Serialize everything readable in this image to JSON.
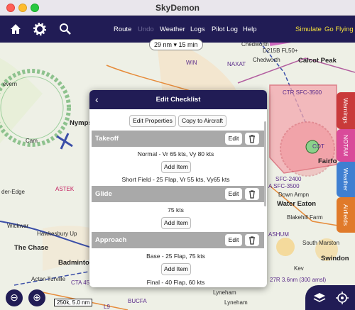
{
  "window": {
    "title": "SkyDemon"
  },
  "toolbar": {
    "icons": [
      "home-icon",
      "gear-icon",
      "search-icon"
    ],
    "menu": {
      "route": "Route",
      "undo": "Undo",
      "weather": "Weather",
      "logs": "Logs",
      "pilot_log": "Pilot Log",
      "help": "Help",
      "simulate": "Simulate",
      "go_flying": "Go Flying"
    },
    "colors": {
      "background": "#211c55",
      "accent": "#f5e13a"
    }
  },
  "map": {
    "zoom": {
      "label": "29 nm ▾ 15 min"
    },
    "labels": {
      "chedworth1": "Chedworth",
      "chedworth2": "Chedworth",
      "d215b": "D215B FL50+",
      "calcot": "Calcot Peak",
      "naxat": "NAXAT",
      "win": "WIN",
      "ctr": "CTR SFC-3500",
      "evern": "evern",
      "nympsfield": "Nymps",
      "cam": "Cam",
      "astek": "ASTEK",
      "edge": "der-Edge",
      "wickwar": "Wickwar",
      "hawkesbury": "Hawkesbury Up",
      "chase": "The Chase",
      "badminton": "Badminton",
      "acton": "Acton Turville",
      "cta": "CTA 4500",
      "bucfa": "BUCFA",
      "lyneham1": "Lyneham",
      "lyneham2": "Lyneham",
      "fairford": "Fairfo",
      "sfc2400": "SFC-2400",
      "sfc2500": "A SFC-3500",
      "downamp": "Down Ampn",
      "watereaton": "Water Eaton",
      "blakehill": "Blakehill Farm",
      "ashum": "ASHUM",
      "southmarston": "South Marston",
      "kev": "Kev",
      "swindon": "Swindon",
      "rwy": "27R 3.6nm (300 amsl)",
      "l9": "L9",
      "cot": "COT"
    },
    "scale": "250k, 5.0 nm",
    "controls": {
      "zoom_out": "⊖",
      "locate": "⊕"
    }
  },
  "side_tabs": [
    {
      "label": "Warnings",
      "color": "#c93a3a"
    },
    {
      "label": "NOTAM",
      "color": "#d94a9a"
    },
    {
      "label": "Weather",
      "color": "#3f7fd1"
    },
    {
      "label": "Airfields",
      "color": "#e07a2a"
    }
  ],
  "dialog": {
    "title": "Edit Checklist",
    "back": "‹",
    "buttons": {
      "edit_properties": "Edit Properties",
      "copy_to_aircraft": "Copy to Aircraft"
    },
    "sections": [
      {
        "name": "Takeoff",
        "edit_label": "Edit",
        "items": [
          "Normal - Vr 65 kts, Vy 80 kts"
        ],
        "add_label": "Add Item",
        "after_add": [
          "Short Field - 25 Flap, Vr 55 kts, Vy65 kts"
        ]
      },
      {
        "name": "Glide",
        "edit_label": "Edit",
        "items": [
          "75 kts"
        ],
        "add_label": "Add Item",
        "after_add": []
      },
      {
        "name": "Approach",
        "edit_label": "Edit",
        "items": [
          "Base - 25 Flap, 75 kts"
        ],
        "add_label": "Add Item",
        "after_add": [
          "Final - 40 Flap, 60 kts"
        ]
      }
    ]
  }
}
